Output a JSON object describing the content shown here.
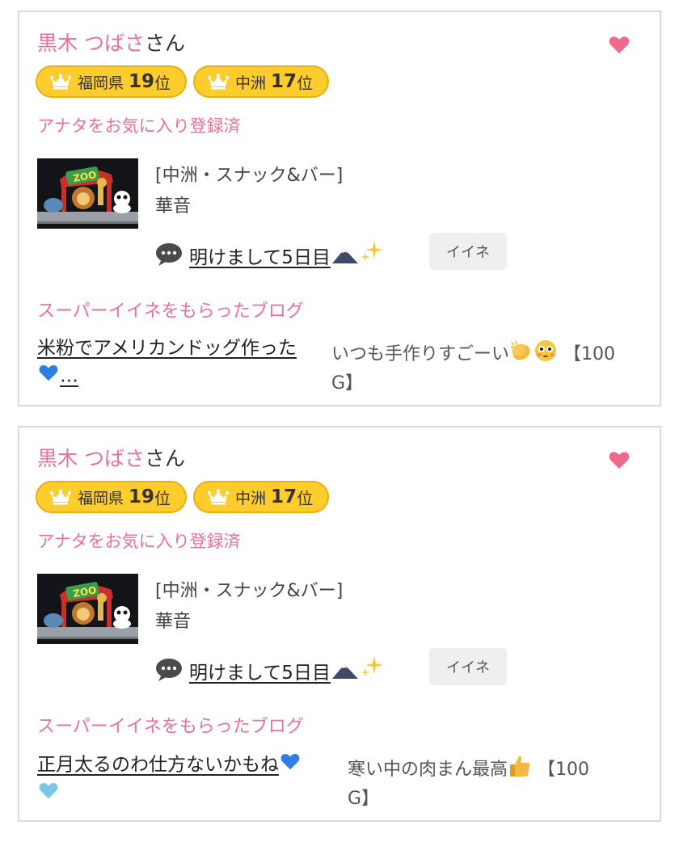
{
  "cards": [
    {
      "user_name": "黒木 つばさ",
      "user_suffix": "さん",
      "ranks": [
        {
          "area": "福岡県",
          "rank": "19",
          "unit": "位"
        },
        {
          "area": "中洲",
          "rank": "17",
          "unit": "位"
        }
      ],
      "favorite_status": "アナタをお気に入り登録済",
      "shop_category": "[中洲・スナック&バー]",
      "shop_name": "華音",
      "post_title": "明けまして5日目",
      "like_button": "イイネ",
      "super_label": "スーパーイイネをもらったブログ",
      "blog_line1": "米粉でアメリカンドッグ作った",
      "blog_line2": "…",
      "comment_line1": "いつも手作りすごーい",
      "comment_reward": "【100",
      "comment_line2": "G】"
    },
    {
      "user_name": "黒木 つばさ",
      "user_suffix": "さん",
      "ranks": [
        {
          "area": "福岡県",
          "rank": "19",
          "unit": "位"
        },
        {
          "area": "中洲",
          "rank": "17",
          "unit": "位"
        }
      ],
      "favorite_status": "アナタをお気に入り登録済",
      "shop_category": "[中洲・スナック&バー]",
      "shop_name": "華音",
      "post_title": "明けまして5日目",
      "like_button": "イイネ",
      "super_label": "スーパーイイネをもらったブログ",
      "blog_line1": "正月太るのわ仕方ないかもね",
      "blog_line2": "",
      "comment_line1": "寒い中の肉まん最高",
      "comment_reward": "【100",
      "comment_line2": "G】"
    }
  ],
  "icons": {
    "heart": "heart-icon",
    "crown": "crown-icon",
    "bubble": "speech-bubble-icon",
    "thumbnail": "zoo-thumbnail"
  },
  "colors": {
    "accent_pink": "#e8709a",
    "badge_yellow": "#ffcc2e",
    "heart": "#f06a8e"
  }
}
